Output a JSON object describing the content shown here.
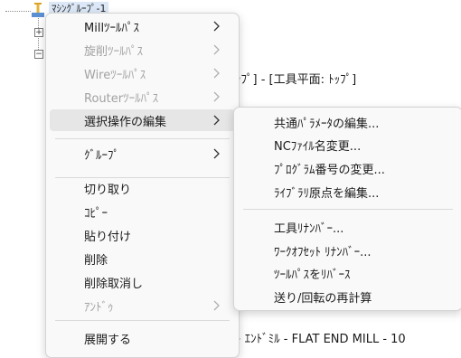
{
  "tree": {
    "root_label": "ﾏｼﾝｸﾞﾙｰﾌﾟ-1",
    "line_text_1": "ｯﾌﾟ] - [工具平面: ﾄｯﾌﾟ]",
    "line_text_2": "ﾄ ｴﾝﾄﾞﾐﾙ - FLAT END MILL - 10"
  },
  "context_menu": {
    "items": [
      {
        "label": "Millﾂｰﾙﾊﾟｽ",
        "enabled": true,
        "submenu": true
      },
      {
        "label": "旋削ﾂｰﾙﾊﾟｽ",
        "enabled": false,
        "submenu": true
      },
      {
        "label": "Wireﾂｰﾙﾊﾟｽ",
        "enabled": false,
        "submenu": true
      },
      {
        "label": "Routerﾂｰﾙﾊﾟｽ",
        "enabled": false,
        "submenu": true
      },
      {
        "label": "選択操作の編集",
        "enabled": true,
        "submenu": true,
        "highlighted": true
      },
      {
        "label": "ｸﾞﾙｰﾌﾟ",
        "enabled": true,
        "submenu": true
      },
      {
        "label": "切り取り",
        "enabled": true
      },
      {
        "label": "ｺﾋﾟｰ",
        "enabled": true
      },
      {
        "label": "貼り付け",
        "enabled": true
      },
      {
        "label": "削除",
        "enabled": true
      },
      {
        "label": "削除取消し",
        "enabled": true
      },
      {
        "label": "ｱﾝﾄﾞｩ",
        "enabled": false,
        "submenu": true
      },
      {
        "label": "展開する",
        "enabled": true
      }
    ]
  },
  "submenu": {
    "items": [
      {
        "label": "共通ﾊﾟﾗﾒｰﾀの編集..."
      },
      {
        "label": "NCﾌｧｲﾙ名変更..."
      },
      {
        "label": "ﾌﾟﾛｸﾞﾗﾑ番号の変更..."
      },
      {
        "label": "ﾗｲﾌﾞﾗﾘ原点を編集..."
      },
      {
        "label": "工具ﾘﾅﾝﾊﾞｰ..."
      },
      {
        "label": "ﾜｰｸｵﾌｾｯﾄ ﾘﾅﾝﾊﾞｰ..."
      },
      {
        "label": "ﾂｰﾙﾊﾟｽをﾘﾊﾞｰｽ"
      },
      {
        "label": "送り/回転の再計算"
      }
    ]
  },
  "icons": {
    "submenu_arrow": "chevron-right-icon",
    "group_icon": "machine-group-icon"
  },
  "colors": {
    "menu_bg": "#f9f9f9",
    "highlight_bg": "#e6e6e6",
    "disabled_text": "#a2a2a2",
    "selection_bg": "#dce8f7"
  }
}
